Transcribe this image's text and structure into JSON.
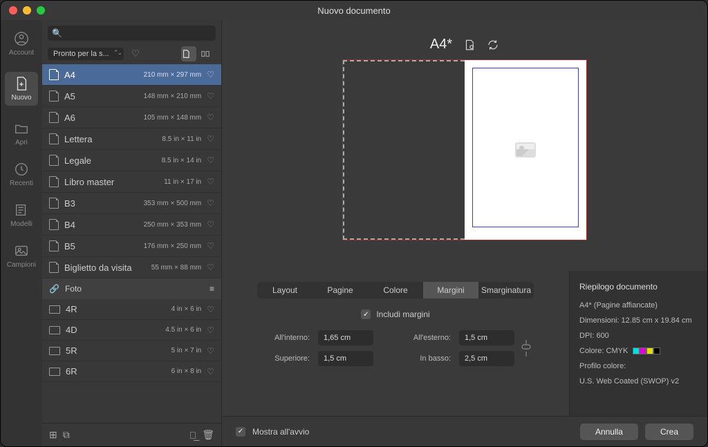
{
  "window": {
    "title": "Nuovo documento"
  },
  "sidebar": {
    "items": [
      {
        "label": "Account"
      },
      {
        "label": "Nuovo"
      },
      {
        "label": "Apri"
      },
      {
        "label": "Recenti"
      },
      {
        "label": "Modelli"
      },
      {
        "label": "Campioni"
      }
    ]
  },
  "presets": {
    "search_placeholder": "",
    "filter_label": "Pronto per la s...",
    "items": [
      {
        "name": "A4",
        "dim": "210 mm × 297 mm",
        "kind": "page"
      },
      {
        "name": "A5",
        "dim": "148 mm × 210 mm",
        "kind": "page"
      },
      {
        "name": "A6",
        "dim": "105 mm × 148 mm",
        "kind": "page"
      },
      {
        "name": "Lettera",
        "dim": "8.5 in × 11 in",
        "kind": "page"
      },
      {
        "name": "Legale",
        "dim": "8.5 in × 14 in",
        "kind": "page"
      },
      {
        "name": "Libro master",
        "dim": "11 in × 17 in",
        "kind": "page"
      },
      {
        "name": "B3",
        "dim": "353 mm × 500 mm",
        "kind": "page"
      },
      {
        "name": "B4",
        "dim": "250 mm × 353 mm",
        "kind": "page"
      },
      {
        "name": "B5",
        "dim": "176 mm × 250 mm",
        "kind": "page"
      },
      {
        "name": "Biglietto da visita",
        "dim": "55 mm × 88 mm",
        "kind": "page"
      }
    ],
    "category": "Foto",
    "photo_items": [
      {
        "name": "4R",
        "dim": "4 in × 6 in"
      },
      {
        "name": "4D",
        "dim": "4.5 in × 6 in"
      },
      {
        "name": "5R",
        "dim": "5 in × 7 in"
      },
      {
        "name": "6R",
        "dim": "6 in × 8 in"
      }
    ]
  },
  "preview": {
    "title": "A4*"
  },
  "tabs": {
    "items": [
      "Layout",
      "Pagine",
      "Colore",
      "Margini",
      "Smarginatura"
    ],
    "active": 3
  },
  "margins": {
    "include_label": "Includi margini",
    "inner_label": "All'interno:",
    "inner_value": "1,65 cm",
    "outer_label": "All'esterno:",
    "outer_value": "1,5 cm",
    "top_label": "Superiore:",
    "top_value": "1,5 cm",
    "bottom_label": "In basso:",
    "bottom_value": "2,5 cm"
  },
  "summary": {
    "title": "Riepilogo documento",
    "format": "A4* (Pagine affiancate)",
    "dimensions": "Dimensioni: 12.85 cm x 19.84 cm",
    "dpi": "DPI:  600",
    "color_label": "Colore: CMYK",
    "profile_label": "Profilo colore:",
    "profile_value": "U.S. Web Coated (SWOP) v2"
  },
  "footer": {
    "show_on_start": "Mostra all'avvio",
    "cancel": "Annulla",
    "create": "Crea"
  }
}
